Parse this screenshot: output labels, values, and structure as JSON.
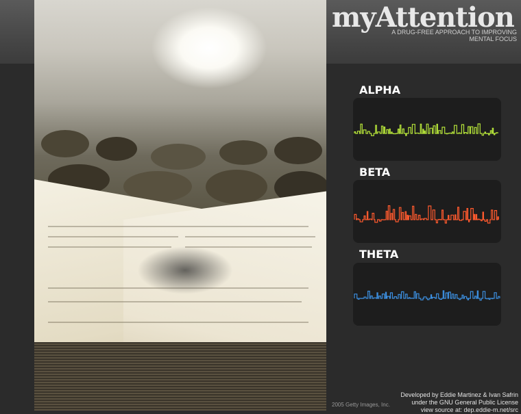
{
  "app": {
    "logo": "myAttention",
    "tagline": "A DRUG-FREE APPROACH TO IMPROVING MENTAL FOCUS"
  },
  "photo": {
    "credit": "2005 Getty Images, Inc."
  },
  "waves": [
    {
      "label": "ALPHA",
      "color": "#b6e43a"
    },
    {
      "label": "BETA",
      "color": "#ff5a2e"
    },
    {
      "label": "THETA",
      "color": "#3c8fe0"
    }
  ],
  "footer": {
    "line1": "Developed by Eddie Martinez & Ivan Safrin",
    "line2": "under the GNU General Public License",
    "line3": "view source at: dep.eddie-m.net/src"
  }
}
